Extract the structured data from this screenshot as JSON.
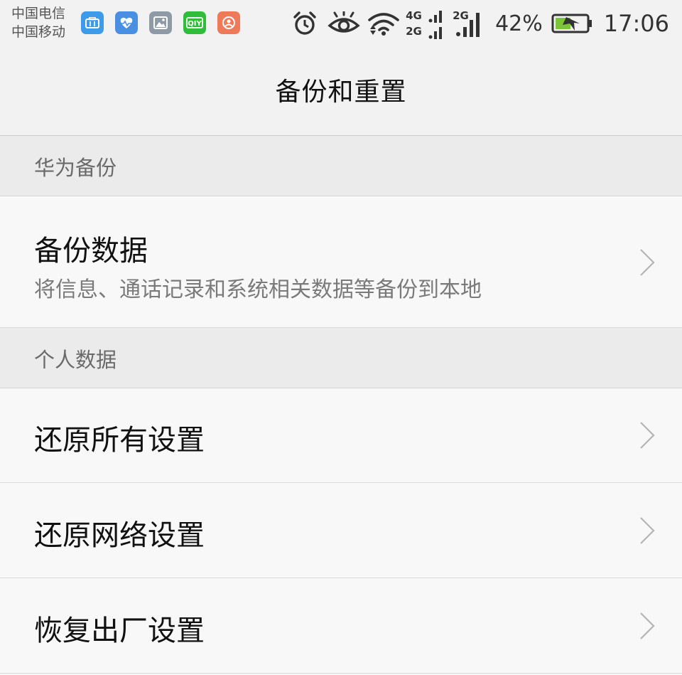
{
  "status_bar": {
    "carriers": [
      "中国电信",
      "中国移动"
    ],
    "notification_icons": [
      {
        "name": "toolbox-app-icon",
        "color": "#3d9be9"
      },
      {
        "name": "health-app-icon",
        "color": "#4a90e2"
      },
      {
        "name": "gallery-app-icon",
        "color": "#8e9aa6"
      },
      {
        "name": "iqiyi-app-icon",
        "color": "#2fbd3a"
      },
      {
        "name": "assistant-app-icon",
        "color": "#ef7a5a"
      }
    ],
    "network_primary": "4G",
    "network_secondary": "2G",
    "network_second_sim": "2G",
    "battery_percent": "42%",
    "time": "17:06"
  },
  "header": {
    "title": "备份和重置"
  },
  "sections": [
    {
      "title": "华为备份",
      "items": [
        {
          "title": "备份数据",
          "subtitle": "将信息、通话记录和系统相关数据等备份到本地"
        }
      ]
    },
    {
      "title": "个人数据",
      "items": [
        {
          "title": "还原所有设置"
        },
        {
          "title": "还原网络设置"
        },
        {
          "title": "恢复出厂设置"
        }
      ]
    }
  ],
  "colors": {
    "battery_fill": "#7cc43a",
    "section_background": "#ebebeb",
    "item_background": "#f8f8f8"
  }
}
